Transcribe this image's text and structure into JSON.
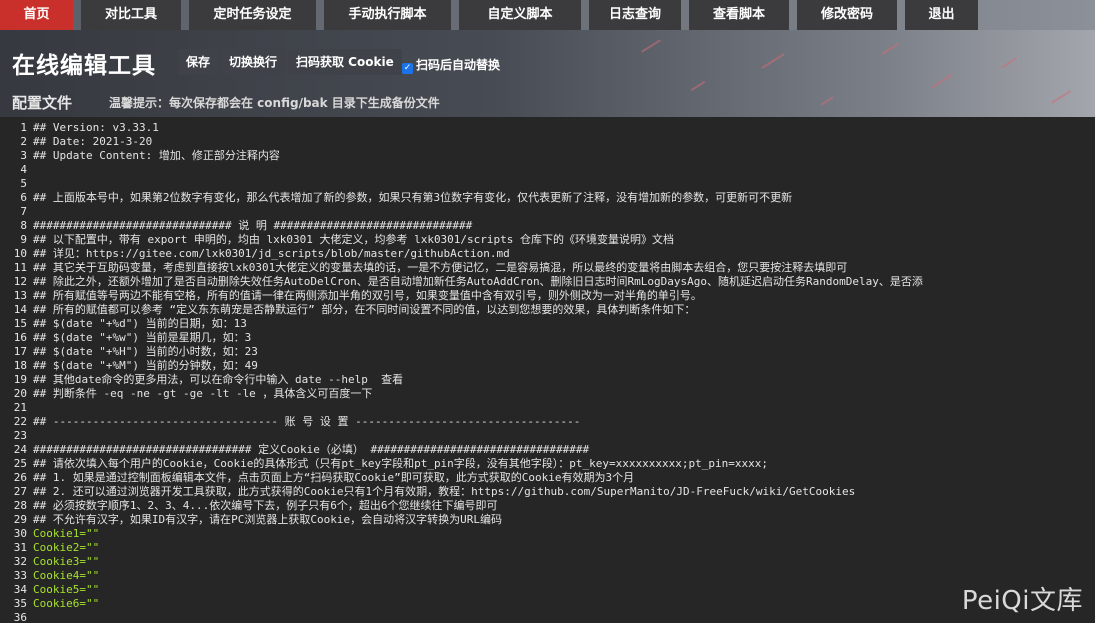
{
  "nav": {
    "items": [
      "首页",
      "对比工具",
      "定时任务设定",
      "手动执行脚本",
      "自定义脚本",
      "日志查询",
      "查看脚本",
      "修改密码",
      "退出"
    ],
    "active": "首页"
  },
  "header": {
    "title": "在线编辑工具",
    "buttons": [
      "保存",
      "切换换行",
      "扫码获取 Cookie"
    ],
    "auto_replace_label": "扫码后自动替换",
    "auto_replace_checked": true,
    "section": "配置文件",
    "tip": "温馨提示：每次保存都会在 config/bak 目录下生成备份文件"
  },
  "editor": {
    "lines": [
      "## Version: v3.33.1",
      "## Date: 2021-3-20",
      "## Update Content: 增加、修正部分注释内容",
      "",
      "",
      "## 上面版本号中，如果第2位数字有变化，那么代表增加了新的参数，如果只有第3位数字有变化，仅代表更新了注释，没有增加新的参数，可更新可不更新",
      "",
      "############################## 说 明 ##############################",
      "## 以下配置中，带有 export 申明的，均由 lxk0301 大佬定义，均参考 lxk0301/scripts 仓库下的《环境变量说明》文档",
      "## 详见：https://gitee.com/lxk0301/jd_scripts/blob/master/githubAction.md",
      "## 其它关于互助码变量，考虑到直接按lxk0301大佬定义的变量去填的话，一是不方便记忆，二是容易搞混，所以最终的变量将由脚本去组合，您只要按注释去填即可",
      "## 除此之外，还额外增加了是否自动删除失效任务AutoDelCron、是否自动增加新任务AutoAddCron、删除旧日志时间RmLogDaysAgo、随机延迟启动任务RandomDelay、是否添",
      "## 所有赋值等号两边不能有空格，所有的值请一律在两侧添加半角的双引号，如果变量值中含有双引号，则外侧改为一对半角的单引号。",
      "## 所有的赋值都可以参考 “定义东东萌宠是否静默运行” 部分，在不同时间设置不同的值，以达到您想要的效果，具体判断条件如下：",
      "## $(date \"+%d\") 当前的日期，如：13",
      "## $(date \"+%w\") 当前是星期几，如：3",
      "## $(date \"+%H\") 当前的小时数，如：23",
      "## $(date \"+%M\") 当前的分钟数，如：49",
      "## 其他date命令的更多用法，可以在命令行中输入 date --help  查看",
      "## 判断条件 -eq -ne -gt -ge -lt -le ，具体含义可百度一下",
      "",
      "## ---------------------------------- 账 号 设 置 ----------------------------------",
      "",
      "################################# 定义Cookie（必填） #################################",
      "## 请依次填入每个用户的Cookie，Cookie的具体形式（只有pt_key字段和pt_pin字段，没有其他字段）：pt_key=xxxxxxxxxx;pt_pin=xxxx;",
      "## 1. 如果是通过控制面板编辑本文件，点击页面上方“扫码获取Cookie”即可获取，此方式获取的Cookie有效期为3个月",
      "## 2. 还可以通过浏览器开发工具获取，此方式获得的Cookie只有1个月有效期，教程：https://github.com/SuperManito/JD-FreeFuck/wiki/GetCookies",
      "## 必须按数字顺序1、2、3、4...依次编号下去，例子只有6个，超出6个您继续往下编号即可",
      "## 不允许有汉字，如果ID有汉字，请在PC浏览器上获取Cookie，会自动将汉字转换为URL编码",
      "Cookie1=\"\"",
      "Cookie2=\"\"",
      "Cookie3=\"\"",
      "Cookie4=\"\"",
      "Cookie5=\"\"",
      "Cookie6=\"\"",
      ""
    ],
    "highlight_color": "#a6e22e"
  },
  "watermark": "PeiQi文库"
}
